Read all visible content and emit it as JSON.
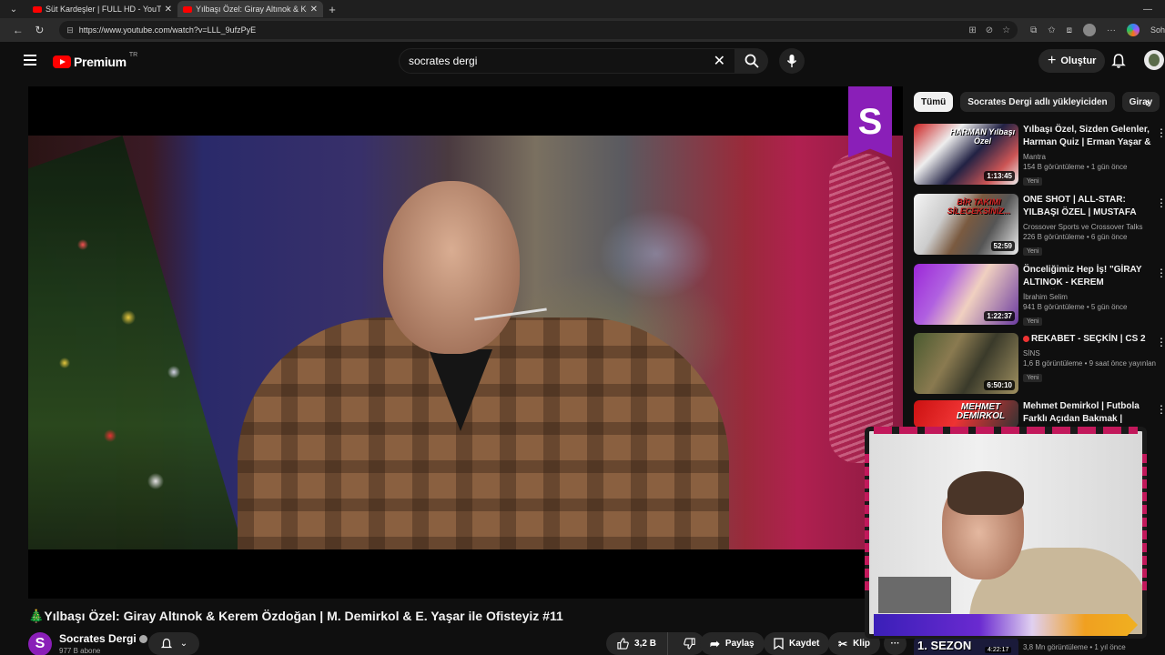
{
  "browser": {
    "tabs": [
      {
        "title": "Süt Kardeşler | FULL HD - YouTube",
        "active": false
      },
      {
        "title": "Yılbaşı Özel: Giray Altınok & Kerem",
        "active": true
      }
    ],
    "url": "https://www.youtube.com/watch?v=LLL_9ufzPyE",
    "sohbet_label": "Soh"
  },
  "youtube": {
    "logo_text": "Premium",
    "logo_region": "TR",
    "search_value": "socrates dergi",
    "create_label": "Oluştur"
  },
  "player": {
    "channel_badge": "S"
  },
  "video": {
    "title": "🎄Yılbaşı Özel: Giray Altınok & Kerem Özdoğan | M. Demirkol & E. Yaşar ile Ofisteyiz #11",
    "channel_name": "Socrates Dergi",
    "channel_initial": "S",
    "subscribers": "977 B abone",
    "likes": "3,2 B",
    "share_label": "Paylaş",
    "save_label": "Kaydet",
    "clip_label": "Klip",
    "more_label": "···"
  },
  "sidebar": {
    "chips": [
      "Tümü",
      "Socrates Dergi adlı yükleyiciden",
      "Giray"
    ],
    "recommendations": [
      {
        "title": "Yılbaşı Özel, Sizden Gelenler, Harman Quiz | Erman Yaşar & ...",
        "channel": "Mantra",
        "stats": "154 B görüntüleme • 1 gün önce",
        "badge": "Yeni",
        "duration": "1:13:45",
        "thumb_text": "HARMAN Yılbaşı Özel"
      },
      {
        "title": "ONE SHOT | ALL-STAR: YILBAŞI ÖZEL | MUSTAFA DEMİRTAŞ, ...",
        "channel": "Crossover Sports ve Crossover Talks",
        "stats": "226 B görüntüleme • 6 gün önce",
        "badge": "Yeni",
        "duration": "52:59",
        "thumb_text": "BİR TAKIMI SİLECEKSİNİZ..."
      },
      {
        "title": "Önceliğimiz Hep İş! \"GİRAY ALTINOK - KEREM ÖZDOĞAN\" ...",
        "channel": "İbrahim Selim",
        "stats": "941 B görüntüleme • 5 gün önce",
        "badge": "Yeni",
        "duration": "1:22:37",
        "thumb_text": ""
      },
      {
        "title": "REKABET - SEÇKİN | CS 2",
        "channel": "SİNS",
        "stats": "1,6 B görüntüleme • 9 saat önce yayınlan...",
        "badge": "Yeni",
        "duration": "6:50:10",
        "thumb_text": ""
      },
      {
        "title": "Mehmet Demirkol | Futbola Farklı Açıdan Bakmak | Kimsin...",
        "channel": "",
        "stats": "",
        "badge": "",
        "duration": "",
        "thumb_text": "MEHMET DEMİRKOL"
      }
    ],
    "bottom_item": {
      "thumb_text": "1. SEZON",
      "duration": "4:22:17",
      "stats": "3,8 Mn görüntüleme • 1 yıl önce"
    }
  }
}
